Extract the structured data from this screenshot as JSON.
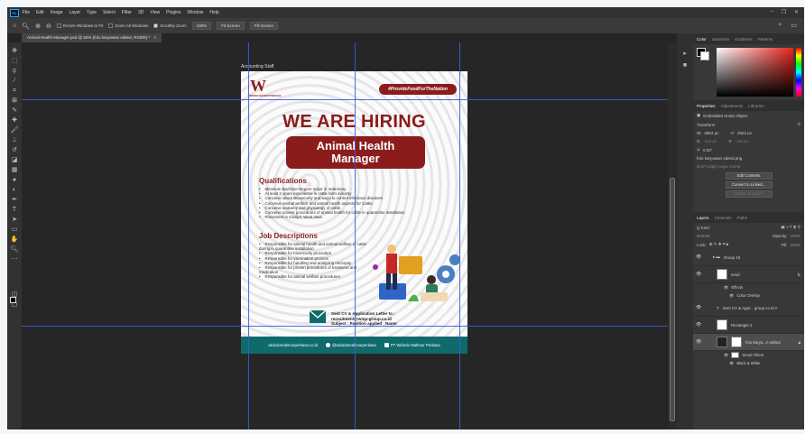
{
  "menubar": {
    "app_logo": "Ps",
    "items": [
      "File",
      "Edit",
      "Image",
      "Layer",
      "Type",
      "Select",
      "Filter",
      "3D",
      "View",
      "Plugins",
      "Window",
      "Help"
    ],
    "window_controls": [
      "–",
      "❐",
      "✕"
    ]
  },
  "options_bar": {
    "resize_windows_label": "Resize Windows to Fit",
    "zoom_all_label": "Zoom All Windows",
    "scrubby_zoom_label": "Scrubby Zoom",
    "zoom_value": "100%",
    "fit_screen_label": "Fit Screen",
    "fill_screen_label": "Fill Screen"
  },
  "document_tab": {
    "title": "Animal Health Manager.psd @ 50% (foto karyawan edited, RGB/8) *",
    "close": "×"
  },
  "artboard": {
    "label": "Accounting Staff"
  },
  "poster": {
    "logo_letter": "W",
    "logo_text": "WIDODO MAKMUR PERKASA",
    "hashtag": "#ProvideFoodForTheNation",
    "headline": "WE ARE HIRING",
    "job_title_line1": "Animal Health",
    "job_title_line2": "Manager",
    "qualifications_title": "Qualifications",
    "qualifications": [
      "Minimum Bachelor Degree major in Veterinary",
      "At least 2 years experience in cattle farm industry",
      "Conceive about Biosecurity and ways to control infectious diseases",
      "Conceive animal welfare and animal health aspects for Cattle",
      "Conceive anatomy and physiology of cattle",
      "Conceive proven procedures of animal health for cattle in quarantine installation",
      "Placement in Cianjur, West Java"
    ],
    "job_desc_title": "Job Descriptions",
    "job_descriptions": [
      "Responsible for animal health and animal welfare of cattle during in quarantine installation",
      "Responsible for biosecurity procedure",
      "Responsible for vaccination process",
      "Responsible for handling and analyzing necropsy",
      "Responsible for proven procedures of treatment and medication",
      "Responsible for animal welfare procedures"
    ],
    "cv_line1": "Sent CV & Application Letter to :",
    "cv_line2": "recruitment@wmp-group.co.id",
    "cv_line3": "Subject : Position applied _Name",
    "footer_website": "widodomakmurperkasa.co.id",
    "footer_instagram": "@widodomakmurperkasa",
    "footer_linkedin": "PT Widodo Makmur Perkasa"
  },
  "color_panel": {
    "tabs": [
      "Color",
      "Swatches",
      "Gradients",
      "Patterns"
    ],
    "colors": {
      "hue_base": "#e8221c",
      "fg": "#000000",
      "bg": "#ffffff"
    }
  },
  "properties_panel": {
    "tabs": [
      "Properties",
      "Adjustments",
      "Libraries"
    ],
    "kind": "Embedded Smart Object",
    "transform_label": "Transform",
    "w_label": "W:",
    "w_value": "2864 px",
    "h_label": "H:",
    "h_value": "2822 px",
    "x_label": "X:",
    "x_value": "-153 px",
    "y_label": "Y:",
    "y_value": "-182 px",
    "angle": "0.00°",
    "filename": "foto karyawan edited.png",
    "layer_comp_placeholder": "Don't Apply Layer Comp",
    "edit_contents": "Edit Contents",
    "convert_linked": "Convert to Linked...",
    "convert_layers": "Convert to Layers"
  },
  "layers_panel": {
    "tabs": [
      "Layers",
      "Channels",
      "Paths"
    ],
    "kind_label": "Q Kind",
    "blend_mode": "Normal",
    "opacity_label": "Opacity:",
    "opacity_value": "100%",
    "lock_label": "Lock:",
    "fill_label": "Fill:",
    "fill_value": "100%",
    "layers": [
      {
        "name": "Group 16",
        "type": "group"
      },
      {
        "name": "send",
        "type": "smart"
      },
      {
        "name": "Effects",
        "type": "effects"
      },
      {
        "name": "Color Overlay",
        "type": "effect"
      },
      {
        "name": "Sent CV & Appl... group.co.id A",
        "type": "text"
      },
      {
        "name": "Rectangle 2",
        "type": "shape"
      },
      {
        "name": "foto karya...n edited",
        "type": "smart",
        "selected": true
      },
      {
        "name": "Smart Filters",
        "type": "filters"
      },
      {
        "name": "Black & White",
        "type": "filter"
      }
    ]
  }
}
